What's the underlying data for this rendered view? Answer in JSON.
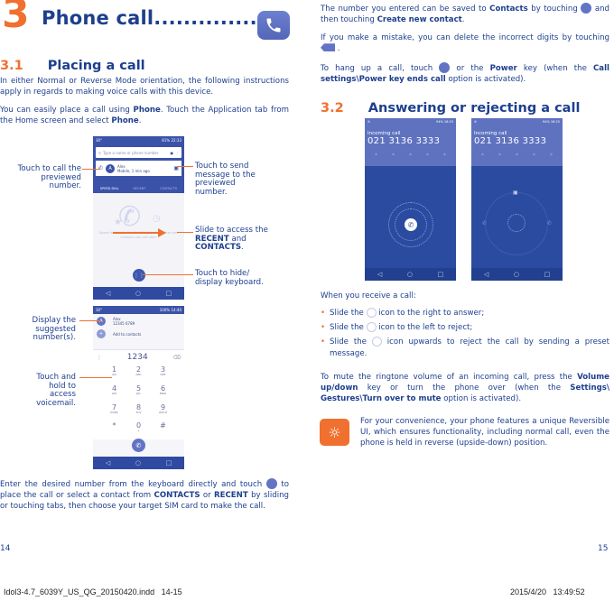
{
  "left_page": {
    "chapter": {
      "number": "3",
      "title": "Phone call................",
      "icon": "phone-app-icon"
    },
    "section_1": {
      "number": "3.1",
      "title": "Placing a call"
    },
    "para_1": "In either Normal or Reverse Mode orientation, the following instructions apply in regards to making voice calls with this device.",
    "para_2": {
      "pre": "You can easily place a call using ",
      "b1": "Phone",
      "mid": ". Touch the Application tab from the Home screen and select ",
      "b2": "Phone",
      "post": "."
    },
    "callouts": {
      "touch_call": "Touch to call the previewed number.",
      "touch_send": "Touch to send message to the previewed number.",
      "slide_pre": "Slide to access the ",
      "slide_b1": "RECENT",
      "slide_and": " and ",
      "slide_b2": "CONTACTS",
      "slide_post": ".",
      "touch_keyboard": "Touch to hide/ display keyboard.",
      "display_suggested": "Display the suggested number(s).",
      "touch_hold": "Touch and hold to access voicemail."
    },
    "screen_1": {
      "status_left": "30°",
      "status_right": "81% 22:33",
      "search_placeholder": "Type a name or phone number",
      "contact_initial": "A",
      "contact_name": "Alex",
      "contact_detail": "Mobile, 1 min ago",
      "tabs": [
        "SPEED DIAL",
        "RECENT",
        "CONTACTS"
      ],
      "empty_text": "Speed dial is one touch dialling for Favourites and numbers you call often"
    },
    "screen_2": {
      "status_left": "30°",
      "status_right": "100% 14:40",
      "suggest_initial": "A",
      "suggest_name": "Alex",
      "suggest_number": "12345 6789",
      "add_contacts": "Add to contacts",
      "dialed": "1234",
      "keys": [
        {
          "d": "1",
          "l": "QO"
        },
        {
          "d": "2",
          "l": "ABC"
        },
        {
          "d": "3",
          "l": "DEF"
        },
        {
          "d": "4",
          "l": "GHI"
        },
        {
          "d": "5",
          "l": "JKL"
        },
        {
          "d": "6",
          "l": "MNO"
        },
        {
          "d": "7",
          "l": "PQRS"
        },
        {
          "d": "8",
          "l": "TUV"
        },
        {
          "d": "9",
          "l": "WXYZ"
        },
        {
          "d": "*",
          "l": ""
        },
        {
          "d": "0",
          "l": "+"
        },
        {
          "d": "#",
          "l": ""
        }
      ]
    },
    "para_3": {
      "pre": "Enter the desired number from the keyboard directly and touch ",
      "mid1": " to place the call or select a contact from ",
      "b1": "CONTACTS",
      "mid2": " or ",
      "b2": "RECENT",
      "post": " by sliding or touching tabs, then choose your target SIM card to make the call."
    },
    "page_number": "14"
  },
  "right_page": {
    "para_1": {
      "pre": "The number you entered can be saved to ",
      "b1": "Contacts",
      "mid": " by touching ",
      "mid2": " and then touching ",
      "b2": "Create new contact",
      "post": "."
    },
    "para_2": {
      "pre": "If you make a mistake, you can delete the incorrect digits by touching ",
      "post": " ."
    },
    "para_3": {
      "pre": "To hang up a call, touch ",
      "mid": " or the ",
      "b1": "Power",
      "mid2": " key (when the ",
      "b2": "Call settings\\Power key ends call",
      "post": " option is activated)."
    },
    "section_2": {
      "number": "3.2",
      "title": "Answering or rejecting a call"
    },
    "incoming_1": {
      "status_right": "94% 16:25",
      "label": "Incoming call",
      "number": "021 3136 3333"
    },
    "incoming_2": {
      "status_right": "94% 16:25",
      "label": "Incoming call",
      "number": "021 3136 3333"
    },
    "when_receive": "When you receive a call:",
    "bullets": [
      {
        "pre": "Slide the ",
        "post": " icon to the right to answer;"
      },
      {
        "pre": "Slide the ",
        "post": " icon to the left to reject;"
      },
      {
        "pre": "Slide the ",
        "post": " icon upwards to reject the call by sending a preset message."
      }
    ],
    "mute_para": {
      "pre": "To mute the ringtone volume of an incoming call, press the ",
      "b1": "Volume up/down",
      "mid": " key or turn the phone over (when the ",
      "b2": "Settings\\ Gestures\\Turn over to mute",
      "post": " option is activated)."
    },
    "tip": "For your convenience, your phone features a unique Reversible UI, which ensures functionality, including normal call, even the phone is held in reverse (upside-down) position.",
    "page_number": "15"
  },
  "footer": {
    "file": "Idol3-4.7_6039Y_US_QG_20150420.indd   14-15",
    "timestamp": "2015/4/20   13:49:52"
  },
  "colors": {
    "brand_blue": "#1d3f8e",
    "accent_orange": "#f07030",
    "screen_blue": "#2f4aa0",
    "icon_purple": "#6274c4"
  }
}
